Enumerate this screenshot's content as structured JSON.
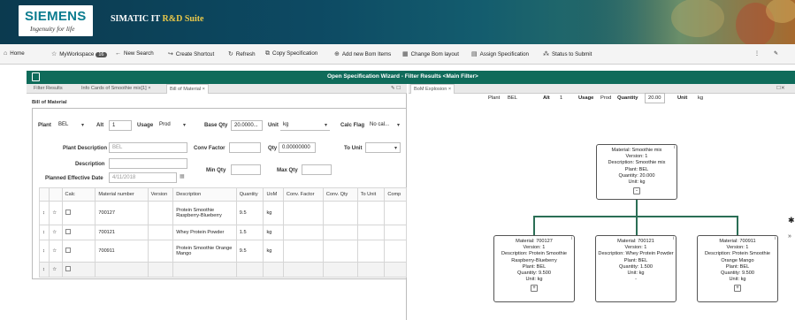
{
  "header": {
    "logo_brand": "SIEMENS",
    "logo_tagline": "Ingenuity for life",
    "app_title_main": "SIMATIC IT",
    "app_title_accent": "R&D Suite"
  },
  "toolbar": {
    "home": "Home",
    "myworkspace": "MyWorkspace",
    "myworkspace_badge": "16",
    "new_search": "New Search",
    "create_shortcut": "Create Shortcut",
    "refresh": "Refresh",
    "copy_specification": "Copy Specification",
    "add_new_bom_items": "Add new Bom Items",
    "change_bom_layout": "Change Bom layout",
    "assign_specification": "Assign Specification",
    "status_to_submit": "Status to Submit"
  },
  "wizard": {
    "title": "Open Specification Wizard - Filter Results <Main Filter>"
  },
  "left_tabs": [
    "Filter Results",
    "Info Cards of Smoothie mix[1] ×",
    "Bill of Material ×"
  ],
  "right_tab": "BoM Explosion ×",
  "form": {
    "section_title": "Bill of Material",
    "plant_label": "Plant",
    "plant_value": "BEL",
    "alt_label": "Alt",
    "alt_value": "1",
    "usage_label": "Usage",
    "usage_value": "Prod",
    "base_qty_label": "Base Qty",
    "base_qty_value": "20.0000...",
    "unit_label": "Unit",
    "unit_value": "kg",
    "calc_flag_label": "Calc Flag",
    "calc_flag_value": "No cal...",
    "plant_desc_label": "Plant Description",
    "plant_desc_value": "BEL",
    "conv_factor_label": "Conv Factor",
    "conv_factor_value": "",
    "qty_label": "Qty",
    "qty_value": "0.00000000",
    "to_unit_label": "To Unit",
    "to_unit_value": "",
    "description_label": "Description",
    "description_value": "",
    "planned_eff_label": "Planned Effective Date",
    "planned_eff_value": "4/11/2018",
    "min_qty_label": "Min Qty",
    "min_qty_value": "",
    "max_qty_label": "Max Qty",
    "max_qty_value": ""
  },
  "table": {
    "columns": [
      "Calc",
      "Material number",
      "Version",
      "Description",
      "Quantity",
      "UoM",
      "Conv. Factor",
      "Conv. Qty",
      "To Unit",
      "Comp"
    ],
    "rows": [
      {
        "material": "700127",
        "version": "",
        "description": "Protein Smoothie Raspberry-Blueberry",
        "quantity": "9.5",
        "uom": "kg"
      },
      {
        "material": "700121",
        "version": "",
        "description": "Whey Protein Powder",
        "quantity": "1.5",
        "uom": "kg"
      },
      {
        "material": "700911",
        "version": "",
        "description": "Protein Smoothie Orange Mango",
        "quantity": "9.5",
        "uom": "kg"
      },
      {
        "material": "",
        "version": "",
        "description": "",
        "quantity": "",
        "uom": ""
      }
    ]
  },
  "explosion_header": {
    "plant_label": "Plant",
    "plant_value": "BEL",
    "alt_label": "Alt",
    "alt_value": "1",
    "usage_label": "Usage",
    "usage_value": "Prod",
    "quantity_label": "Quantity",
    "quantity_value": "20.00",
    "unit_label": "Unit",
    "unit_value": "kg"
  },
  "nodes": {
    "root": {
      "material": "Material: Smoothie mix",
      "version": "Version: 1",
      "description": "Description: Smoothie mix",
      "plant": "Plant: BEL",
      "quantity": "Quantity: 20.000",
      "unit": "Unit: kg",
      "toggle": "-"
    },
    "c1": {
      "material": "Material: 700127",
      "version": "Version: 1",
      "description": "Description: Protein Smoothie Raspberry-Blueberry",
      "plant": "Plant: BEL",
      "quantity": "Quantity: 9.500",
      "unit": "Unit: kg",
      "toggle": "+"
    },
    "c2": {
      "material": "Material: 700121",
      "version": "Version: 1",
      "description": "Description: Whey Protein Powder",
      "plant": "Plant: BEL",
      "quantity": "Quantity: 1.500",
      "unit": "Unit: kg",
      "toggle": "-"
    },
    "c3": {
      "material": "Material: 700911",
      "version": "Version: 1",
      "description": "Description: Protein Smoothie Orange Mango",
      "plant": "Plant: BEL",
      "quantity": "Quantity: 9.500",
      "unit": "Unit: kg",
      "toggle": "+"
    }
  }
}
